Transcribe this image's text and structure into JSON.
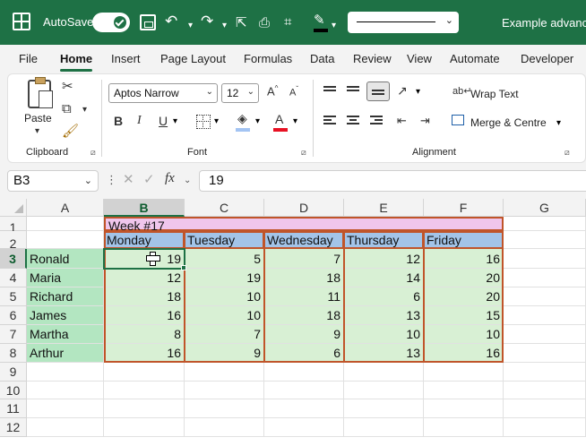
{
  "titlebar": {
    "autosave_label": "AutoSave",
    "autosave_on": true,
    "document_title": "Example advance",
    "colors": {
      "background": "#1e7145",
      "text": "#ffffff"
    }
  },
  "tabs": [
    "File",
    "Home",
    "Insert",
    "Page Layout",
    "Formulas",
    "Data",
    "Review",
    "View",
    "Automate",
    "Developer"
  ],
  "active_tab": "Home",
  "ribbon": {
    "clipboard": {
      "paste_label": "Paste",
      "group_label": "Clipboard"
    },
    "font": {
      "font_name": "Aptos Narrow",
      "font_size": "12",
      "group_label": "Font",
      "fill_color": "#a3c4f3",
      "font_color": "#e81123"
    },
    "alignment": {
      "wrap_text_label": "Wrap Text",
      "merge_label": "Merge & Centre",
      "group_label": "Alignment"
    }
  },
  "formula_bar": {
    "name_box": "B3",
    "formula": "19"
  },
  "sheet": {
    "columns": [
      "A",
      "B",
      "C",
      "D",
      "E",
      "F",
      "G"
    ],
    "rows": [
      "1",
      "2",
      "3",
      "4",
      "5",
      "6",
      "7",
      "8",
      "9",
      "10",
      "11",
      "12"
    ],
    "selected_column": "B",
    "selected_row": "3",
    "title": "Week #17",
    "days": [
      "Monday",
      "Tuesday",
      "Wednesday",
      "Thursday",
      "Friday"
    ],
    "people": [
      {
        "name": "Ronald",
        "values": [
          19,
          5,
          7,
          12,
          16
        ]
      },
      {
        "name": "Maria",
        "values": [
          12,
          19,
          18,
          14,
          20
        ]
      },
      {
        "name": "Richard",
        "values": [
          18,
          10,
          11,
          6,
          20
        ]
      },
      {
        "name": "James",
        "values": [
          16,
          10,
          18,
          13,
          15
        ]
      },
      {
        "name": "Martha",
        "values": [
          8,
          7,
          9,
          10,
          10
        ]
      },
      {
        "name": "Arthur",
        "values": [
          16,
          9,
          6,
          13,
          16
        ]
      }
    ],
    "colors": {
      "title_fill": "#f0c6ec",
      "header_fill": "#a3c4e8",
      "name_fill": "#b3e6c1",
      "data_fill": "#d8f0d4",
      "border": "#c0552a",
      "selection": "#1e7145"
    }
  }
}
